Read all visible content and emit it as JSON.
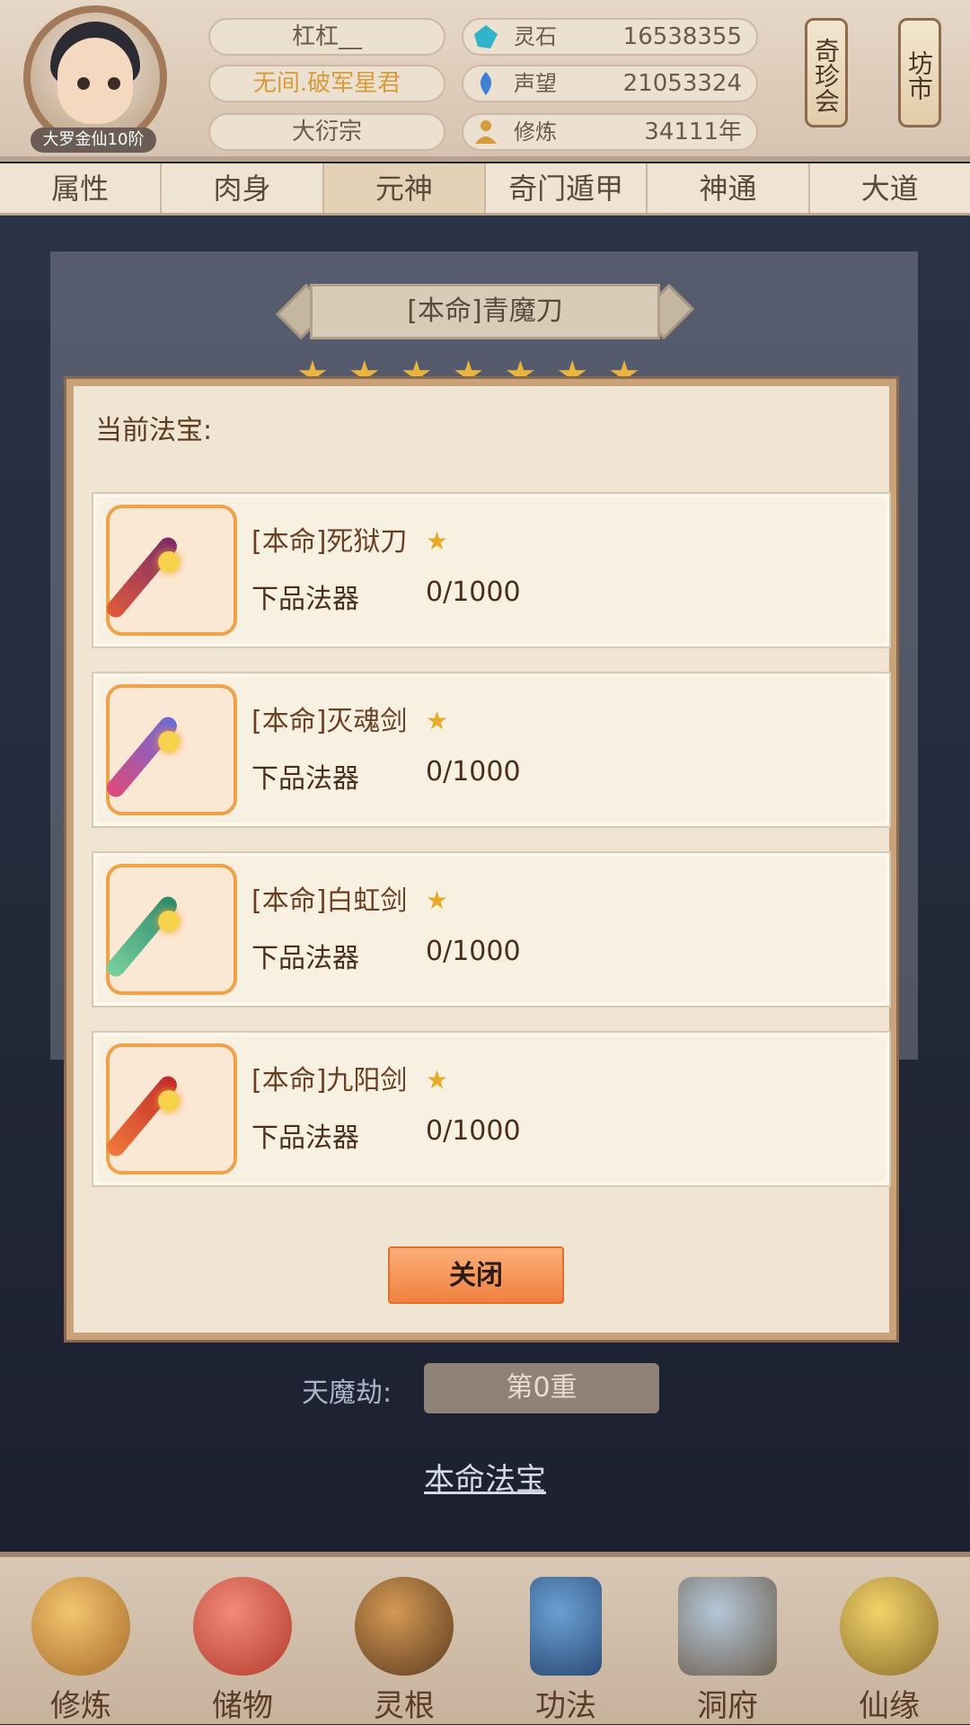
{
  "header": {
    "rank_badge": "大罗金仙10阶",
    "player_name": "杠杠__",
    "title": "无间.破军星君",
    "sect": "大衍宗",
    "resources": [
      {
        "label": "灵石",
        "value": "16538355",
        "icon": "spirit-stone-icon"
      },
      {
        "label": "声望",
        "value": "21053324",
        "icon": "reputation-icon"
      },
      {
        "label": "修炼",
        "value": "34111年",
        "icon": "cultivation-icon"
      }
    ],
    "side_buttons": [
      "奇珍会",
      "坊市"
    ]
  },
  "tabs": [
    "属性",
    "肉身",
    "元神",
    "奇门遁甲",
    "神通",
    "大道"
  ],
  "active_tab": "元神",
  "background": {
    "weapon_name": "[本命]青魔刀",
    "tianmo_label": "天魔劫:",
    "tianmo_value": "第0重",
    "faobao_link": "本命法宝"
  },
  "dialog": {
    "title": "当前法宝:",
    "items": [
      {
        "name": "[本命]死狱刀",
        "grade": "下品法器",
        "count": "0/1000",
        "stars": 1
      },
      {
        "name": "[本命]灭魂剑",
        "grade": "下品法器",
        "count": "0/1000",
        "stars": 1
      },
      {
        "name": "[本命]白虹剑",
        "grade": "下品法器",
        "count": "0/1000",
        "stars": 1
      },
      {
        "name": "[本命]九阳剑",
        "grade": "下品法器",
        "count": "0/1000",
        "stars": 1
      }
    ],
    "close_label": "关闭"
  },
  "bottom_nav": [
    "修炼",
    "储物",
    "灵根",
    "功法",
    "洞府",
    "仙缘"
  ],
  "colors": {
    "accent": "#f0803f",
    "star": "#e7aa2b",
    "panel": "#efe5d2"
  }
}
